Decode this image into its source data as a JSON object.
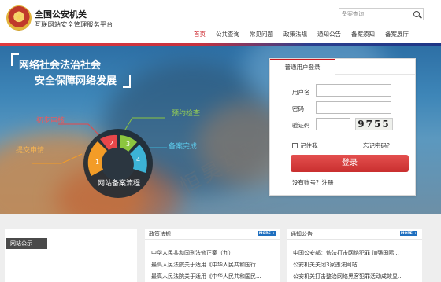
{
  "header": {
    "title": "全国公安机关",
    "subtitle": "互联网站安全管理服务平台",
    "search": {
      "placeholder": "备案查询"
    }
  },
  "nav": {
    "items": [
      "首页",
      "公共查询",
      "常见问题",
      "政策法规",
      "通知公告",
      "备案须知",
      "备案展厅"
    ],
    "active_index": 0
  },
  "banner": {
    "slogan_line1": "网络社会法治社会",
    "slogan_line2": "安全保障网络发展",
    "flow_title": "网站备案流程",
    "steps": [
      {
        "label": "提交申请",
        "number": "1",
        "color": "#f39c27"
      },
      {
        "label": "初步审核",
        "number": "2",
        "color": "#e8474a"
      },
      {
        "label": "预约检查",
        "number": "3",
        "color": "#8cc63f"
      },
      {
        "label": "备案完成",
        "number": "4",
        "color": "#3cb3d6"
      }
    ],
    "watermark": "恒昊互联网络"
  },
  "login": {
    "tab_label": "普通用户登录",
    "username_label": "用户名",
    "password_label": "密码",
    "captcha_label": "验证码",
    "captcha_text": "9755",
    "remember_label": "记住我",
    "forgot_label": "忘记密码？",
    "login_button": "登录",
    "register_label": "没有账号？注册"
  },
  "bottom": {
    "notice_tab": "网站公示",
    "more_label": "MORE +",
    "policy": {
      "title": "政策法规",
      "items": [
        "中华人民共和国刑法修正案（九）",
        "最高人民法院关于适用《中华人民共和国行...",
        "最高人民法院关于适用《中华人民共和国民..."
      ]
    },
    "notice": {
      "title": "通知公告",
      "items": [
        "中国公安部：依法打击网络犯罪 加强国际...",
        "公安机关关闭3家违法网站",
        "公安机关打击整治网络黑客犯罪活动成效显..."
      ]
    }
  }
}
